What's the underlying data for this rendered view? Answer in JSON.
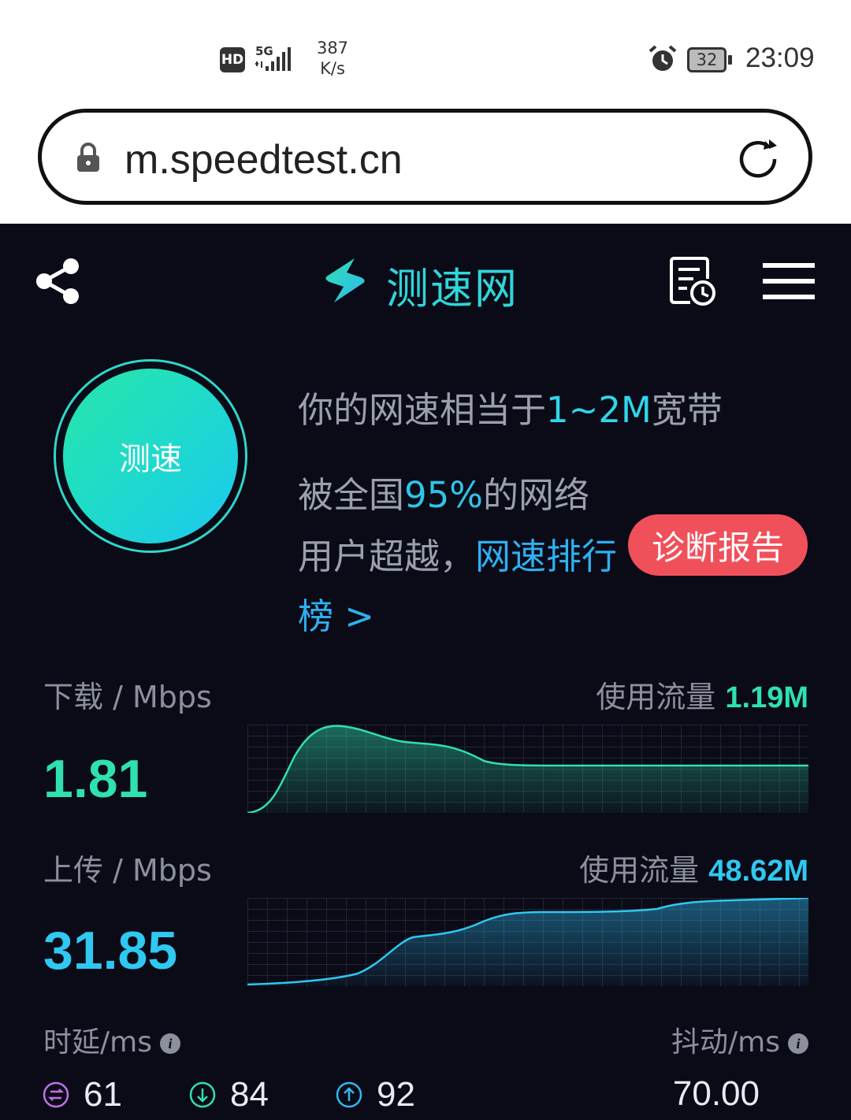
{
  "status_bar": {
    "hd": "HD",
    "network": "5G",
    "speed_value": "387",
    "speed_unit": "K/s",
    "battery": "32",
    "time": "23:09"
  },
  "browser": {
    "url": "m.speedtest.cn"
  },
  "header": {
    "brand": "测速网"
  },
  "test": {
    "button_label": "测速"
  },
  "result": {
    "line1_prefix": "你的网速相当于",
    "line1_value": "1~2M",
    "line1_suffix": "宽带",
    "line2_prefix": "被全国",
    "line2_value": "95%",
    "line2_suffix": "的网络",
    "line3_prefix": "用户超越，",
    "ranking_link": "网速排行",
    "ranking_link_cont": "榜 >",
    "diagnose_button": "诊断报告"
  },
  "download": {
    "label": "下载 / Mbps",
    "value": "1.81",
    "usage_label": "使用流量",
    "usage_value": "1.19M",
    "color": "#2fe0b0"
  },
  "upload": {
    "label": "上传 / Mbps",
    "value": "31.85",
    "usage_label": "使用流量",
    "usage_value": "48.62M",
    "color": "#2fc8f0"
  },
  "latency": {
    "label": "时延/ms",
    "idle": "61",
    "download": "84",
    "upload": "92",
    "idle_icon": "swap-icon",
    "download_icon": "arrow-down-circle-icon",
    "upload_icon": "arrow-up-circle-icon"
  },
  "jitter": {
    "label": "抖动/ms",
    "value": "70.00"
  }
}
